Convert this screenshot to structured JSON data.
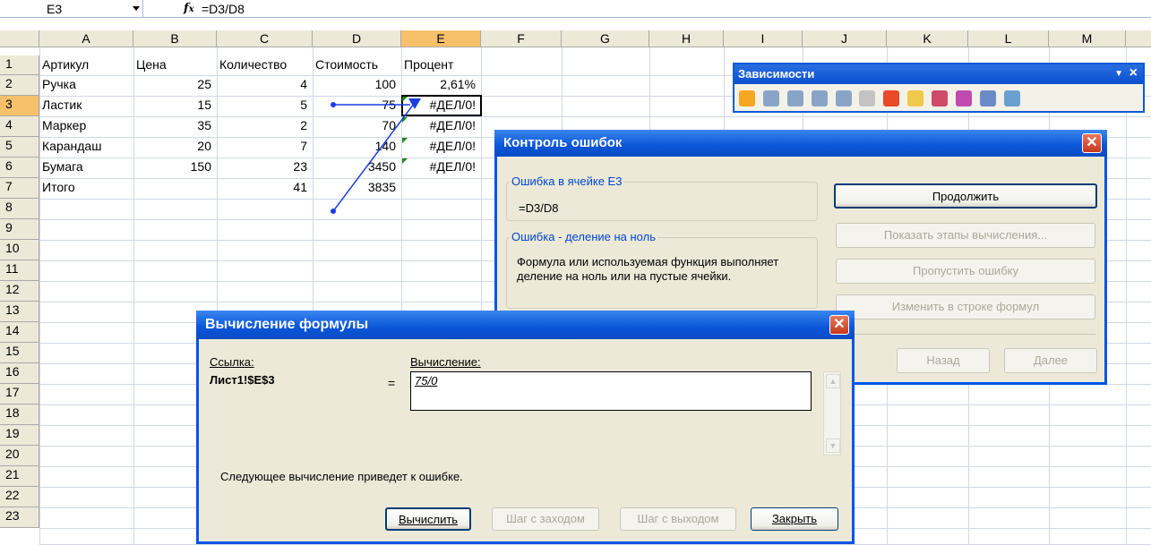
{
  "formula_bar": {
    "name_box": "E3",
    "fx": "fx",
    "formula": "=D3/D8"
  },
  "columns": [
    "A",
    "B",
    "C",
    "D",
    "E",
    "F",
    "G",
    "H",
    "I",
    "J",
    "K",
    "L",
    "M"
  ],
  "rows": [
    "1",
    "2",
    "3",
    "4",
    "5",
    "6",
    "7",
    "8",
    "9",
    "10",
    "11",
    "12",
    "13",
    "14",
    "15",
    "16",
    "17",
    "18",
    "19",
    "20",
    "21",
    "22",
    "23"
  ],
  "sheet": {
    "r1": {
      "a": "Артикул",
      "b": "Цена",
      "c": "Количество",
      "d": "Стоимость",
      "e": "Процент"
    },
    "r2": {
      "a": "Ручка",
      "b": "25",
      "c": "4",
      "d": "100",
      "e": "2,61%"
    },
    "r3": {
      "a": "Ластик",
      "b": "15",
      "c": "5",
      "d": "75",
      "e": "#ДЕЛ/0!"
    },
    "r4": {
      "a": "Маркер",
      "b": "35",
      "c": "2",
      "d": "70",
      "e": "#ДЕЛ/0!"
    },
    "r5": {
      "a": "Карандаш",
      "b": "20",
      "c": "7",
      "d": "140",
      "e": "#ДЕЛ/0!"
    },
    "r6": {
      "a": "Бумага",
      "b": "150",
      "c": "23",
      "d": "3450",
      "e": "#ДЕЛ/0!"
    },
    "r7": {
      "a": "Итого",
      "b": "",
      "c": "41",
      "d": "3835",
      "e": ""
    }
  },
  "toolbar": {
    "title": "Зависимости",
    "close": "×",
    "menu": "▼"
  },
  "error_dialog": {
    "title": "Контроль ошибок",
    "close": "✕",
    "group1_label": "Ошибка в ячейке E3",
    "group1_value": "=D3/D8",
    "group2_label": "Ошибка - деление на ноль",
    "group2_text": "Формула или используемая функция выполняет деление на ноль или на пустые ячейки.",
    "btn_continue": "Продолжить",
    "btn_show_steps": "Показать этапы вычисления...",
    "btn_ignore": "Пропустить ошибку",
    "btn_edit": "Изменить в строке формул",
    "btn_back": "Назад",
    "btn_next": "Далее"
  },
  "eval_dialog": {
    "title": "Вычисление формулы",
    "close": "✕",
    "ref_label": "Ссылка:",
    "ref_value": "Лист1!$E$3",
    "eval_label": "Вычисление:",
    "eq": "=",
    "expression": "75/0",
    "status": "Следующее вычисление приведет к ошибке.",
    "btn_evaluate": "Вычислить",
    "btn_step_in": "Шаг с заходом",
    "btn_step_out": "Шаг с выходом",
    "btn_close": "Закрыть"
  },
  "colors": {
    "accent": "#0055e5",
    "selected_header": "#f7c06b",
    "dialog_bg": "#ece9d8",
    "error_triangle": "#1a8a1a"
  }
}
